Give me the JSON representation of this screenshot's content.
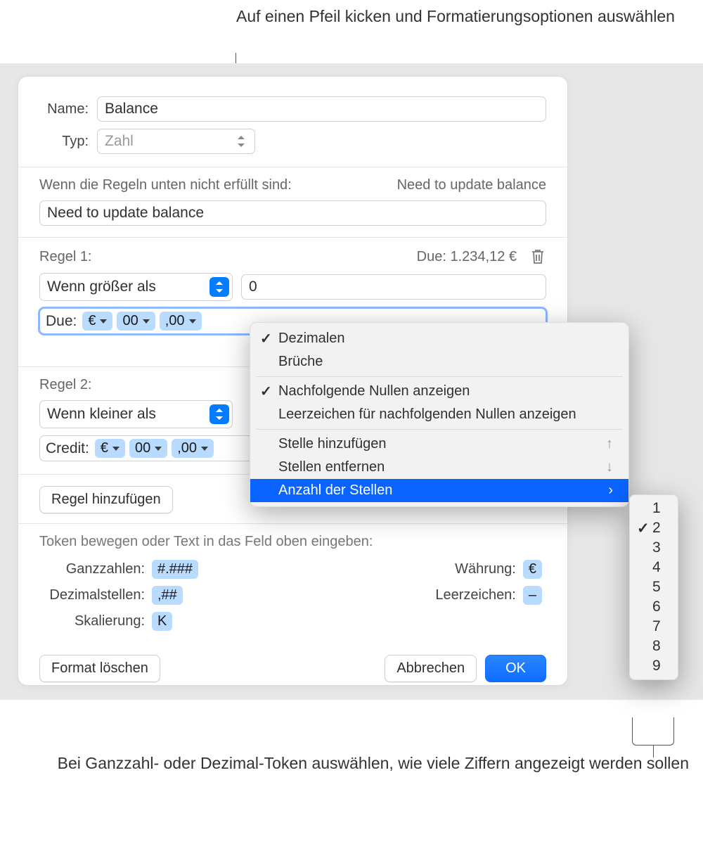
{
  "callouts": {
    "top": "Auf einen Pfeil kicken und Formatierungsoptionen auswählen",
    "bottom": "Bei Ganzzahl- oder Dezimal-Token auswählen, wie viele Ziffern angezeigt werden sollen"
  },
  "form": {
    "name_label": "Name:",
    "name_value": "Balance",
    "type_label": "Typ:",
    "type_value": "Zahl"
  },
  "fallback": {
    "label": "Wenn die Regeln unten nicht erfüllt sind:",
    "preview": "Need to update balance",
    "value": "Need to update balance"
  },
  "rule1": {
    "label": "Regel 1:",
    "preview": "Due: 1.234,12 €",
    "condition": "Wenn größer als",
    "compare_value": "0",
    "prefix": "Due:",
    "tokens": {
      "currency": "€",
      "int": "00",
      "dec": ",00"
    }
  },
  "rule2": {
    "label": "Regel 2:",
    "condition": "Wenn kleiner als",
    "prefix": "Credit:",
    "tokens": {
      "currency": "€",
      "int": "00",
      "dec": ",00"
    }
  },
  "buttons": {
    "add_rule": "Regel hinzufügen",
    "delete_format": "Format löschen",
    "cancel": "Abbrechen",
    "ok": "OK"
  },
  "helper": "Token bewegen oder Text in das Feld oben eingeben:",
  "token_palette": {
    "ganzzahlen_label": "Ganzzahlen:",
    "ganzzahlen": "#.###",
    "dezimal_label": "Dezimalstellen:",
    "dezimal": ",##",
    "skalierung_label": "Skalierung:",
    "skalierung": "K",
    "waehrung_label": "Währung:",
    "waehrung": "€",
    "leerzeichen_label": "Leerzeichen:",
    "leerzeichen": "–"
  },
  "menu": {
    "dezimalen": "Dezimalen",
    "brueche": "Brüche",
    "trailing_zeros": "Nachfolgende Nullen anzeigen",
    "space_trailing": "Leerzeichen für nachfolgenden Nullen anzeigen",
    "add_digit": "Stelle hinzufügen",
    "remove_digit": "Stellen entfernen",
    "digit_count": "Anzahl der Stellen",
    "arrow_up": "↑",
    "arrow_down": "↓",
    "arrow_right": "›"
  },
  "submenu": {
    "v1": "1",
    "v2": "2",
    "v3": "3",
    "v4": "4",
    "v5": "5",
    "v6": "6",
    "v7": "7",
    "v8": "8",
    "v9": "9",
    "selected": "2"
  }
}
